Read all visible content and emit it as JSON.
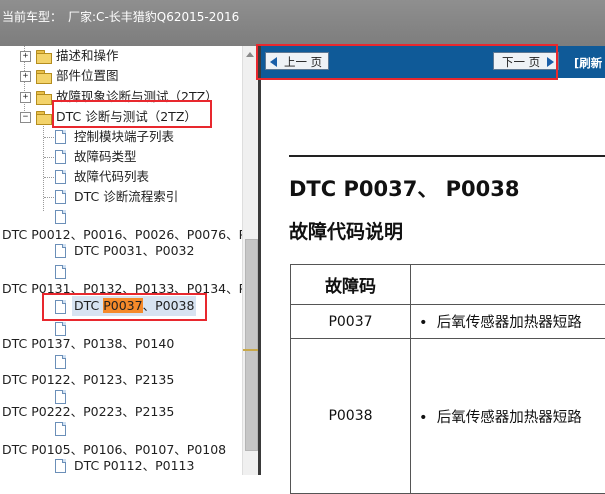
{
  "header": {
    "vehicle_label": "当前车型：",
    "vehicle_value": "厂家:C-长丰猎豹Q62015-2016"
  },
  "tree": {
    "items": [
      {
        "label": "描述和操作",
        "type": "folder",
        "expander": "+"
      },
      {
        "label": "部件位置图",
        "type": "folder",
        "expander": "+"
      },
      {
        "label": "故障现象诊断与测试（2TZ）",
        "type": "folder",
        "expander": "+"
      },
      {
        "label": "DTC 诊断与测试（2TZ）",
        "type": "folder",
        "expander": "−"
      },
      {
        "label": "控制模块端子列表",
        "type": "doc"
      },
      {
        "label": "故障码类型",
        "type": "doc"
      },
      {
        "label": "故障代码列表",
        "type": "doc"
      },
      {
        "label": "DTC 诊断流程索引",
        "type": "doc"
      },
      {
        "label": "DTC P0012、P0016、P0026、P0076、P",
        "type": "group"
      },
      {
        "label": "DTC P0031、P0032",
        "type": "doc"
      },
      {
        "label": "DTC P0131、P0132、P0133、P0134、P",
        "type": "group"
      },
      {
        "label_prefix": "DTC ",
        "label_highlight": "P0037",
        "label_suffix": "、P0038",
        "type": "doc",
        "selected": true
      },
      {
        "label": "DTC P0137、P0138、P0140",
        "type": "group"
      },
      {
        "label": "DTC P0122、P0123、P2135",
        "type": "group"
      },
      {
        "label": "DTC P0222、P0223、P2135",
        "type": "group"
      },
      {
        "label": "DTC P0105、P0106、P0107、P0108",
        "type": "group"
      },
      {
        "label": "DTC P0112、P0113",
        "type": "doc"
      }
    ]
  },
  "nav": {
    "prev_label": "上一 页",
    "next_label": "下一 页",
    "refresh_label": "[刷新"
  },
  "document": {
    "title": "DTC P0037、 P0038",
    "subtitle": "故障代码说明",
    "table": {
      "header_code": "故障码",
      "rows": [
        {
          "code": "P0037",
          "bullet": "•",
          "desc": "后氧传感器加热器短路"
        },
        {
          "code": "P0038",
          "bullet": "•",
          "desc": "后氧传感器加热器短路"
        }
      ]
    }
  },
  "colors": {
    "titlebar": "#8a8a8a",
    "navbar": "#0f5a98",
    "annotation_red": "#e8282e",
    "selection_highlight": "#f58a2a"
  }
}
